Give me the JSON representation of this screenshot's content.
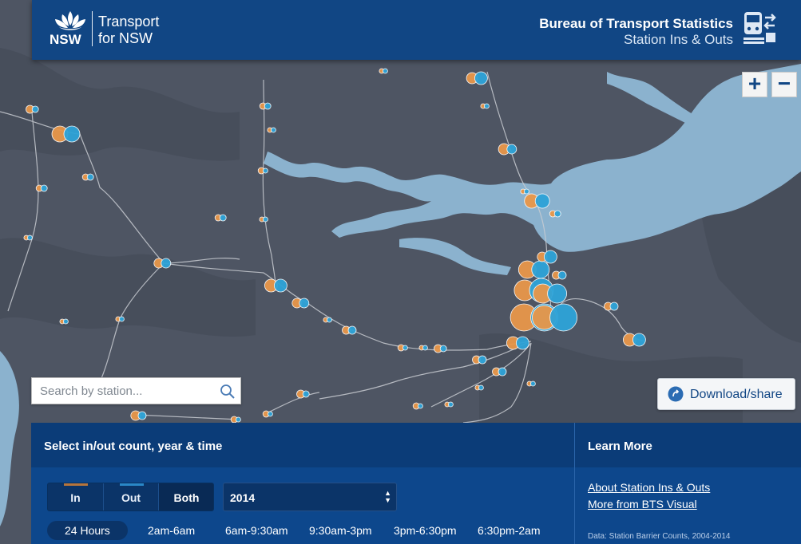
{
  "header": {
    "logo_nsw": "NSW",
    "logo_line1": "Transport",
    "logo_line2": "for NSW",
    "title": "Bureau of Transport Statistics",
    "subtitle": "Station Ins & Outs",
    "icon": "train-swap-icon"
  },
  "map": {
    "zoom_in_label": "+",
    "zoom_out_label": "−",
    "colors": {
      "land": "#4e5563",
      "water": "#8bb2ce",
      "in": "#e8974a",
      "out": "#2ea3d8",
      "rail": "#c9ccd2"
    }
  },
  "search": {
    "placeholder": "Search by station...",
    "icon": "search-icon"
  },
  "download": {
    "label": "Download/share",
    "icon": "share-icon"
  },
  "controls": {
    "title": "Select in/out count, year & time",
    "modes": [
      "In",
      "Out",
      "Both"
    ],
    "active_mode": "Both",
    "year": "2014",
    "times": [
      "24 Hours",
      "2am-6am",
      "6am-9:30am",
      "9:30am-3pm",
      "3pm-6:30pm",
      "6:30pm-2am"
    ],
    "active_time": "24 Hours"
  },
  "learn_more": {
    "title": "Learn More",
    "link1": "About Station Ins & Outs",
    "link2": "More from BTS Visual",
    "note": "Data: Station Barrier Counts, 2004-2014"
  }
}
